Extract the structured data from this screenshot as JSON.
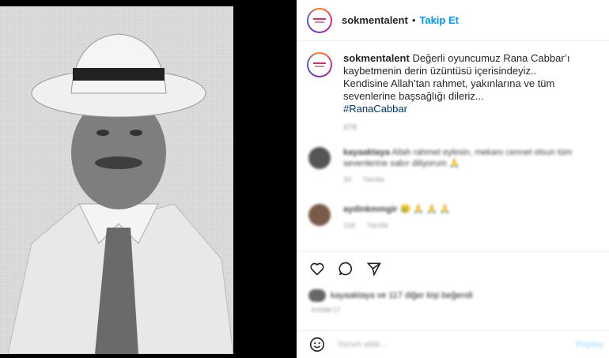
{
  "post": {
    "username": "sokmentalent",
    "follow_label": "Takip Et",
    "dot": "•",
    "caption_line1": "Değerli oyuncumuz Rana Cabbar’ı kaybetmenin derin üzüntüsü içerisindeyiz..",
    "caption_line2": "Kendisine Allah’tan rahmet, yakınlarına ve tüm sevenlerine başsağlığı dileriz...",
    "hashtag": "#RanaCabbar",
    "time": "47d"
  },
  "comments": [
    {
      "username": "kayaaktaya",
      "text": "Allah rahmet eylesin, mekanı cennet olsun tüm sevenlerine sabır diliyorum",
      "emoji": "🙏",
      "meta_time": "3d",
      "meta_reply": "Yanıtla"
    },
    {
      "username": "aydinkmmgir",
      "text": "",
      "emoji": "😢 🙏 🙏 🙏",
      "meta_time": "13d",
      "meta_reply": "Yanıtla"
    }
  ],
  "likes_text": "kayaaktaya ve 117 diğer kişi beğendi",
  "post_date": "KASIM 17",
  "comment_box": {
    "placeholder": "Yorum ekle...",
    "post_label": "Paylaş"
  },
  "icons": [
    "heart-icon",
    "comment-icon",
    "share-icon",
    "emoji-icon"
  ],
  "colors": {
    "follow": "#0095f6",
    "hashtag": "#00376b",
    "left_bg": "#000000"
  }
}
